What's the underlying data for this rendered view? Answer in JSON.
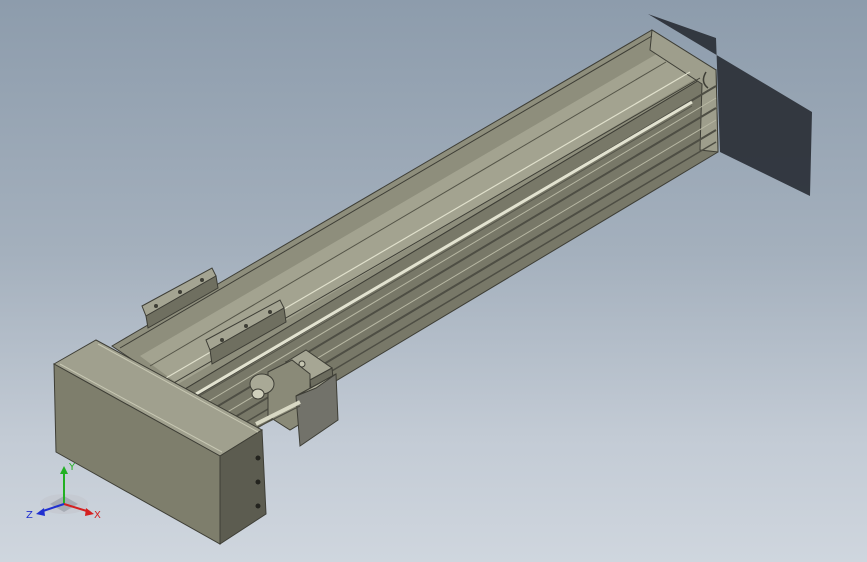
{
  "viewport": {
    "background_top": "#8d9cac",
    "background_bottom": "#cfd6de"
  },
  "model": {
    "body_color": "#8f8f7d",
    "dark_color": "#5e5e52",
    "light_color": "#c8c8b4",
    "shadow_color": "#2a2f36"
  },
  "triad": {
    "x_label": "X",
    "y_label": "Y",
    "z_label": "Z",
    "x_color": "#d42020",
    "y_color": "#22b022",
    "z_color": "#2030d0"
  }
}
